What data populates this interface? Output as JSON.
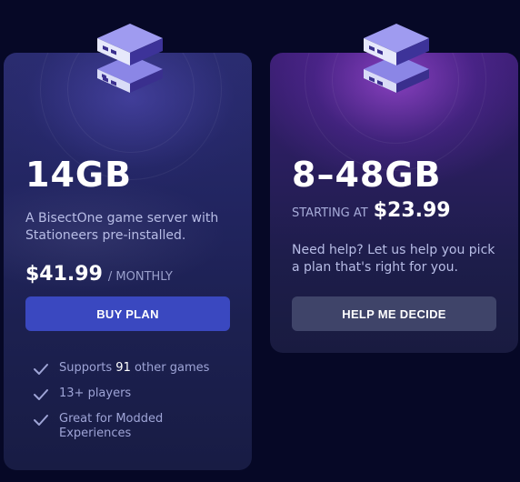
{
  "plans": [
    {
      "size": "14GB",
      "description": "A BisectOne game server with Stationeers pre-installed.",
      "price": "$41.99",
      "period": "/ MONTHLY",
      "button_label": "BUY PLAN",
      "features": [
        {
          "prefix": "Supports ",
          "highlight": "91",
          "suffix": " other games"
        },
        {
          "prefix": "13+ players",
          "highlight": "",
          "suffix": ""
        },
        {
          "prefix": "Great for Modded Experiences",
          "highlight": "",
          "suffix": ""
        }
      ]
    },
    {
      "size": "8–48GB",
      "starting_label": "STARTING AT",
      "price": "$23.99",
      "help_text": "Need help? Let us help you pick a plan that's right for you.",
      "button_label": "HELP ME DECIDE"
    }
  ],
  "colors": {
    "background": "#060826",
    "buy_button": "#3a48c0",
    "help_button": "#3f4469",
    "accent_purple": "#c85aff"
  },
  "icons": {
    "plan_icon": "server-stack-icon",
    "feature_icon": "checkmark-icon"
  }
}
